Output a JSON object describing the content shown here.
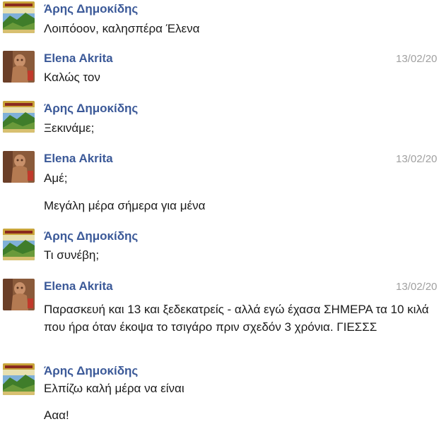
{
  "messages": [
    {
      "sender": "Άρης Δημοκίδης",
      "avatar": "aris-landscape-avatar",
      "time": "",
      "paragraphs": [
        "Λοιπόοον, καλησπέρα Έλενα"
      ]
    },
    {
      "sender": "Elena Akrita",
      "avatar": "elena-sculpture-avatar",
      "time": "13/02/20",
      "paragraphs": [
        "Καλώς τον"
      ]
    },
    {
      "sender": "Άρης Δημοκίδης",
      "avatar": "aris-landscape-avatar",
      "time": "",
      "paragraphs": [
        "Ξεκινάμε;"
      ]
    },
    {
      "sender": "Elena Akrita",
      "avatar": "elena-sculpture-avatar",
      "time": "13/02/20",
      "paragraphs": [
        "Αμέ;",
        "Μεγάλη μέρα σήμερα για μένα"
      ]
    },
    {
      "sender": "Άρης Δημοκίδης",
      "avatar": "aris-landscape-avatar",
      "time": "",
      "paragraphs": [
        "Τι συνέβη;"
      ]
    },
    {
      "sender": "Elena Akrita",
      "avatar": "elena-sculpture-avatar",
      "time": "13/02/20",
      "paragraphs": [
        "Παρασκευή και 13 και ξεδεκατρείς - αλλά εγώ έχασα ΣΗΜΕΡΑ τα 10 κιλά που ήρα όταν έκοψα το τσιγάρο πριν σχεδόν 3 χρόνια. ΓΙΕΣΣΣ"
      ]
    },
    {
      "sender": "Άρης Δημοκίδης",
      "avatar": "aris-landscape-avatar",
      "time": "",
      "paragraphs": [
        "Ελπίζω καλή μέρα να είναι",
        "Ααα!"
      ]
    }
  ]
}
